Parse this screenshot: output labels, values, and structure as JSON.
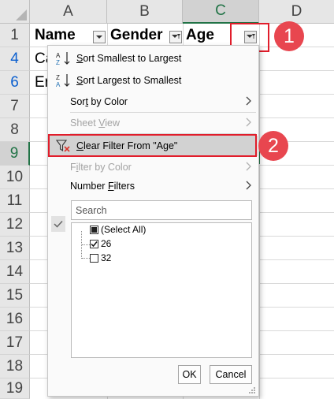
{
  "sheet": {
    "columns": [
      "A",
      "B",
      "C",
      "D"
    ],
    "selected_column": "C",
    "rows": [
      "1",
      "4",
      "6",
      "7",
      "8",
      "9",
      "10",
      "11",
      "12",
      "13",
      "14",
      "15",
      "16",
      "17",
      "18",
      "19"
    ],
    "filtered_rows": [
      "4",
      "6"
    ],
    "selected_row": "9",
    "header_cells": {
      "name": "Name",
      "gender": "Gender",
      "age": "Age"
    },
    "visible_cells": {
      "a4": "Ca",
      "a6": "Er"
    }
  },
  "callouts": {
    "step1": "1",
    "step2": "2"
  },
  "filter_menu": {
    "items": [
      {
        "pre": "",
        "ul": "S",
        "post": "ort Smallest to Largest",
        "icon": "sort-ascending-icon"
      },
      {
        "pre": "",
        "ul": "S",
        "post": "ort Largest to Smallest",
        "icon": "sort-descending-icon"
      },
      {
        "pre": "Sor",
        "ul": "t",
        "post": " by Color"
      },
      {
        "pre": "Sheet ",
        "ul": "V",
        "post": "iew"
      },
      {
        "pre": "",
        "ul": "C",
        "post": "lear Filter From \"Age\"",
        "icon": "clear-filter-icon"
      },
      {
        "pre": "F",
        "ul": "i",
        "post": "lter by Color"
      },
      {
        "pre": "Number ",
        "ul": "F",
        "post": "ilters"
      }
    ],
    "search_placeholder": "Search",
    "values": [
      {
        "label": "(Select All)",
        "state": "partial"
      },
      {
        "label": "26",
        "state": "checked"
      },
      {
        "label": "32",
        "state": "unchecked"
      }
    ],
    "ok_label": "OK",
    "cancel_label": "Cancel"
  },
  "colors": {
    "accent_green": "#217346",
    "callout_red": "#e11d2b",
    "badge_red": "#e8464f",
    "filtered_row_blue": "#0b5fcf"
  }
}
